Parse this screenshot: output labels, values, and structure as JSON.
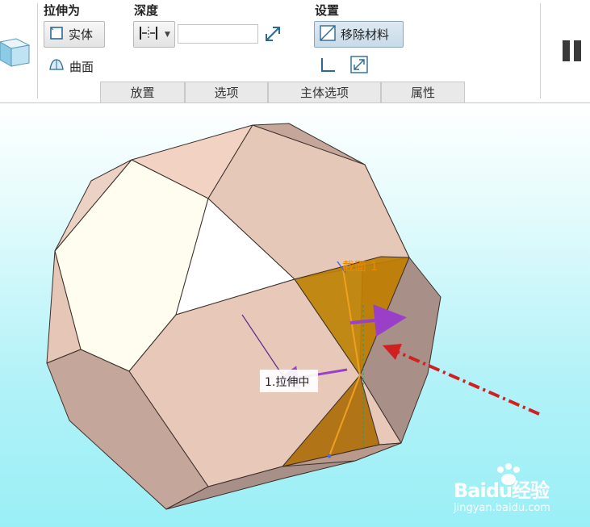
{
  "toolbar": {
    "extrude_as": {
      "label": "拉伸为",
      "solid_label": "实体",
      "surface_label": "曲面"
    },
    "depth": {
      "label": "深度",
      "value": ""
    },
    "settings": {
      "label": "设置",
      "remove_material_label": "移除材料"
    },
    "tabs": [
      "放置",
      "选项",
      "主体选项",
      "属性"
    ]
  },
  "viewport": {
    "sketch_label": "截面 1",
    "center_label": "1.拉伸中"
  },
  "watermark": {
    "logo": "Baidu经验",
    "url": "jingyan.baidu.com"
  },
  "colors": {
    "face_light": "#e8c8b8",
    "face_dark": "#a89088",
    "face_white": "#ffffff",
    "face_cream": "#fffdf0",
    "cut_region": "#c07e00",
    "arrow_purple": "#9a40c8",
    "arrow_red": "#d02020",
    "label_orange": "#e88a00"
  }
}
